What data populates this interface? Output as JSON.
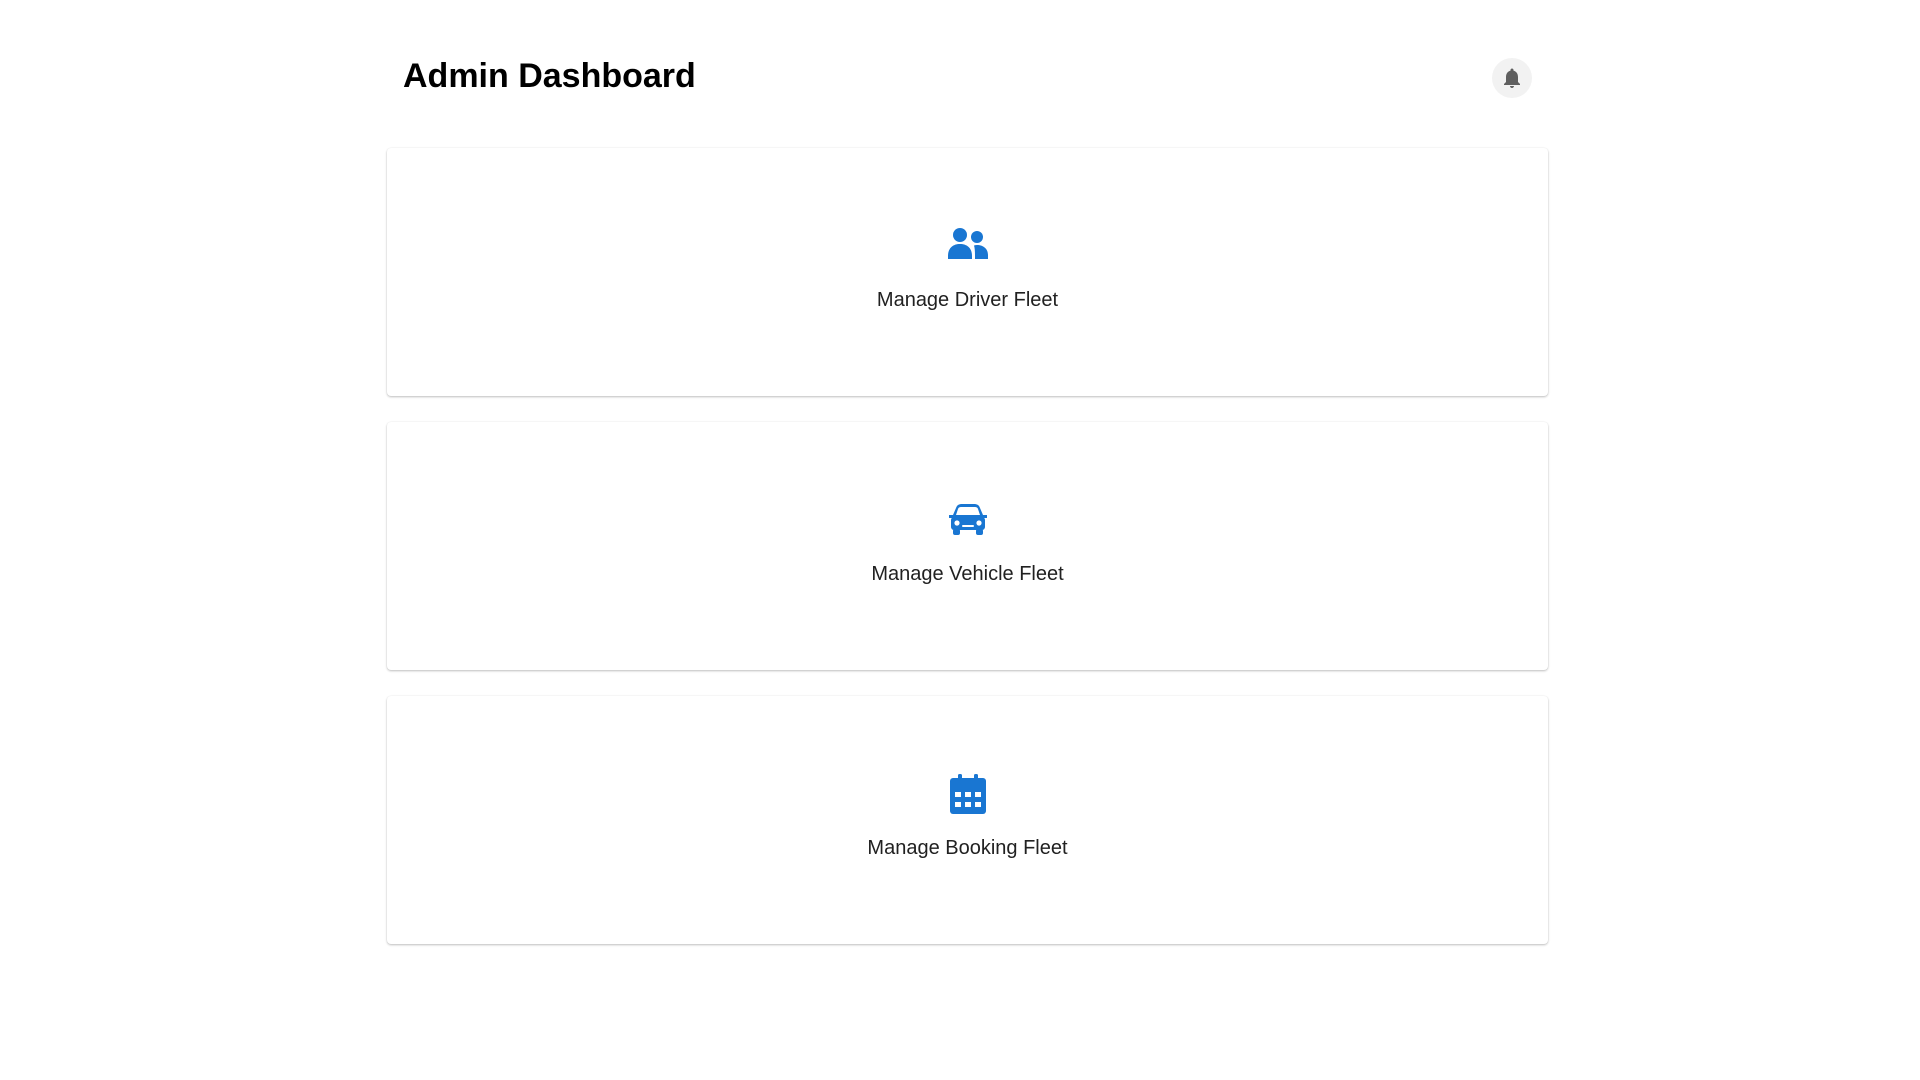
{
  "header": {
    "title": "Admin Dashboard",
    "notification_icon": "bell-icon"
  },
  "colors": {
    "accent": "#1976d2",
    "bell": "#5f5f5f",
    "bell_bg": "#f2f2f2"
  },
  "cards": [
    {
      "label": "Manage Driver Fleet",
      "icon": "people-icon"
    },
    {
      "label": "Manage Vehicle Fleet",
      "icon": "car-icon"
    },
    {
      "label": "Manage Booking Fleet",
      "icon": "calendar-icon"
    }
  ]
}
